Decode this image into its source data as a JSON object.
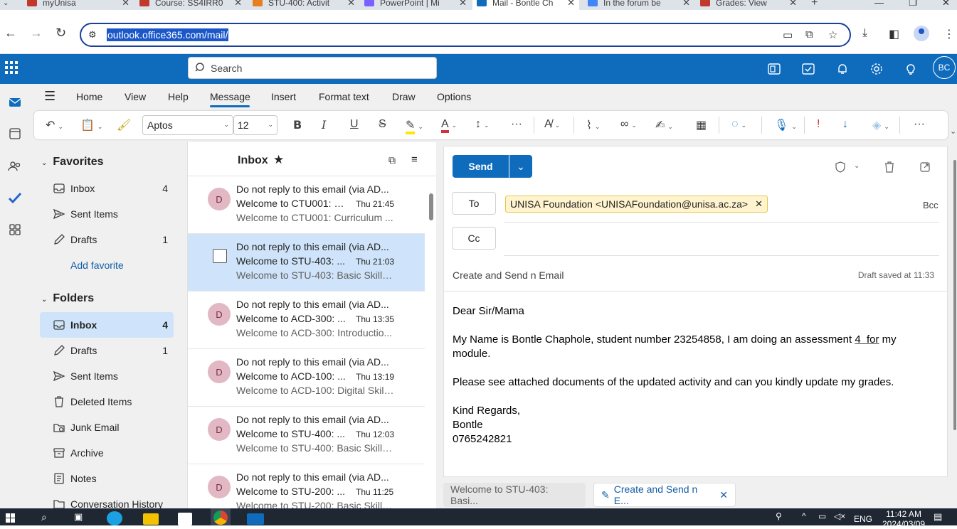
{
  "browser": {
    "tabs": [
      {
        "title": "myUnisa",
        "color": "#c0392b"
      },
      {
        "title": "Course: SS4IRR0",
        "color": "#c0392b"
      },
      {
        "title": "STU-400: Activit",
        "color": "#e67e22"
      },
      {
        "title": "PowerPoint | Mi",
        "color": "#7b61ff"
      },
      {
        "title": "Mail - Bontle Ch",
        "color": "#0f6cbd"
      },
      {
        "title": "In the forum be",
        "color": "#4285f4"
      },
      {
        "title": "Grades: View",
        "color": "#c0392b"
      }
    ],
    "active_tab_index": 4,
    "url": "outlook.office365.com/mail/"
  },
  "outlook": {
    "search_placeholder": "Search",
    "avatar_initials": "BC",
    "ribbon_tabs": [
      "Home",
      "View",
      "Help",
      "Message",
      "Insert",
      "Format text",
      "Draw",
      "Options"
    ],
    "active_ribbon_tab": "Message",
    "font_name": "Aptos",
    "font_size": "12"
  },
  "folders": {
    "favorites_label": "Favorites",
    "favorites": [
      {
        "label": "Inbox",
        "count": "4",
        "icon": "inbox-icon"
      },
      {
        "label": "Sent Items",
        "count": "",
        "icon": "send-icon"
      },
      {
        "label": "Drafts",
        "count": "1",
        "icon": "pencil-icon"
      }
    ],
    "add_favorite": "Add favorite",
    "folders_label": "Folders",
    "folders": [
      {
        "label": "Inbox",
        "count": "4",
        "icon": "inbox-icon",
        "selected": true
      },
      {
        "label": "Drafts",
        "count": "1",
        "icon": "pencil-icon"
      },
      {
        "label": "Sent Items",
        "count": "",
        "icon": "send-icon"
      },
      {
        "label": "Deleted Items",
        "count": "",
        "icon": "trash-icon"
      },
      {
        "label": "Junk Email",
        "count": "",
        "icon": "junk-icon"
      },
      {
        "label": "Archive",
        "count": "",
        "icon": "archive-icon"
      },
      {
        "label": "Notes",
        "count": "",
        "icon": "notes-icon"
      },
      {
        "label": "Conversation History",
        "count": "",
        "icon": "folder-icon"
      }
    ]
  },
  "mail_list": {
    "title": "Inbox",
    "messages": [
      {
        "sender": "Do not reply to this email (via AD...",
        "subject": "Welcome to CTU001: C...",
        "time": "Thu 21:45",
        "preview": "Welcome to CTU001: Curriculum ...",
        "avatar": "D"
      },
      {
        "sender": "Do not reply to this email (via AD...",
        "subject": "Welcome to STU-403: ...",
        "time": "Thu 21:03",
        "preview": "Welcome to STU-403: Basic Skills ...",
        "avatar": "D",
        "selected": true
      },
      {
        "sender": "Do not reply to this email (via AD...",
        "subject": "Welcome to ACD-300: ...",
        "time": "Thu 13:35",
        "preview": "Welcome to ACD-300: Introductio...",
        "avatar": "D"
      },
      {
        "sender": "Do not reply to this email (via AD...",
        "subject": "Welcome to ACD-100: ...",
        "time": "Thu 13:19",
        "preview": "Welcome to ACD-100: Digital Skill...",
        "avatar": "D"
      },
      {
        "sender": "Do not reply to this email (via AD...",
        "subject": "Welcome to STU-400: ...",
        "time": "Thu 12:03",
        "preview": "Welcome to STU-400: Basic Skills ...",
        "avatar": "D"
      },
      {
        "sender": "Do not reply to this email (via AD...",
        "subject": "Welcome to STU-200: ...",
        "time": "Thu 11:25",
        "preview": "Welcome to STU-200: Basic Skills ...",
        "avatar": "D"
      }
    ]
  },
  "compose": {
    "send_label": "Send",
    "to_label": "To",
    "cc_label": "Cc",
    "bcc_label": "Bcc",
    "to_recipient": "UNISA Foundation <UNISAFoundation@unisa.ac.za>",
    "subject": "Create and Send n Email",
    "draft_status": "Draft saved at 11:33",
    "body": {
      "greeting": "Dear Sir/Mama",
      "p1_before": "My Name is Bontle Chaphole, student number 23254858, I am doing an assessment ",
      "p1_underlined": "4  for",
      "p1_after": " my module.",
      "p2": "Please see attached documents of the updated activity and can you kindly update my grades.",
      "closing": "Kind Regards,",
      "name": "Bontle",
      "phone": "0765242821"
    }
  },
  "draft_tabs": {
    "tab1": "Welcome to STU-403: Basi...",
    "tab2": "Create and Send n E..."
  },
  "taskbar": {
    "lang": "ENG",
    "time": "11:42 AM",
    "date": "2024/03/09"
  }
}
